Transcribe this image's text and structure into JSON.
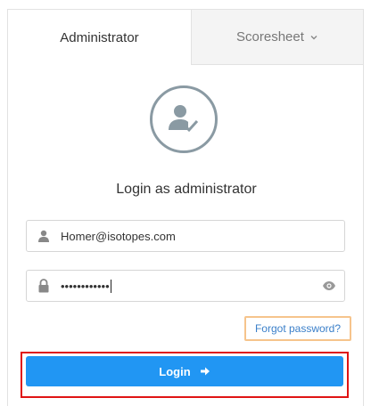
{
  "tabs": [
    {
      "label": "Administrator",
      "active": true
    },
    {
      "label": "Scoresheet",
      "icon": "chevron-down-icon"
    }
  ],
  "avatar": {
    "icon": "user-check-icon",
    "color": "#8a9aa3"
  },
  "login_title": "Login as administrator",
  "email_field": {
    "icon": "user-icon",
    "value": "Homer@isotopes.com"
  },
  "password_field": {
    "icon": "lock-icon",
    "value": "••••••••••••",
    "toggle_icon": "eye-icon"
  },
  "forgot_password": "Forgot password?",
  "login_button": {
    "label": "Login",
    "icon": "arrow-right-icon",
    "color": "#2196f3"
  }
}
